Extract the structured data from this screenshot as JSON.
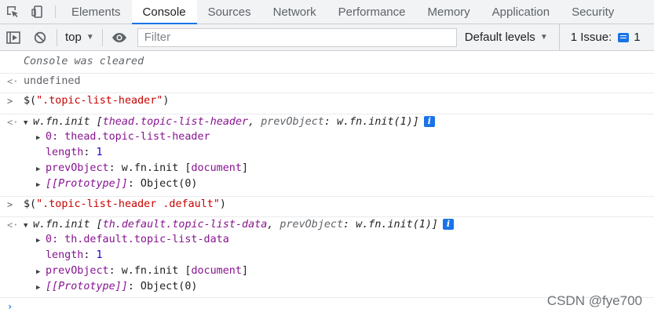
{
  "tabs": [
    "Elements",
    "Console",
    "Sources",
    "Network",
    "Performance",
    "Memory",
    "Application",
    "Security"
  ],
  "active_tab": "Console",
  "toolbar": {
    "context": "top",
    "filter_placeholder": "Filter",
    "levels": "Default levels",
    "issue_label": "1 Issue:",
    "issue_count": "1"
  },
  "console": {
    "cleared": "Console was cleared",
    "undefined": "undefined",
    "cmd1": {
      "prefix": "$(",
      "arg": "\".topic-list-header\"",
      "suffix": ")"
    },
    "result1": {
      "summary_head": "w.fn.init [",
      "summary_node": "thead.topic-list-header",
      "summary_sep": ", ",
      "summary_key": "prevObject",
      "summary_val": ": w.fn.init(1)]",
      "item0_key": "0",
      "item0_val": ": thead.topic-list-header",
      "length_key": "length",
      "length_val": "1",
      "prev_key": "prevObject",
      "prev_val": ": w.fn.init [",
      "prev_doc": "document",
      "prev_end": "]",
      "proto_key": "[[Prototype]]",
      "proto_val": ": Object(0)"
    },
    "cmd2": {
      "prefix": "$(",
      "arg": "\".topic-list-header .default\"",
      "suffix": ")"
    },
    "result2": {
      "summary_head": "w.fn.init [",
      "summary_node": "th.default.topic-list-data",
      "summary_sep": ", ",
      "summary_key": "prevObject",
      "summary_val": ": w.fn.init(1)]",
      "item0_key": "0",
      "item0_val": ": th.default.topic-list-data",
      "length_key": "length",
      "length_val": "1",
      "prev_key": "prevObject",
      "prev_val": ": w.fn.init [",
      "prev_doc": "document",
      "prev_end": "]",
      "proto_key": "[[Prototype]]",
      "proto_val": ": Object(0)"
    }
  },
  "watermark": "CSDN @fye700",
  "colors": {
    "accent": "#1a73e8",
    "key": "#881391",
    "string": "#c80000",
    "number": "#1c00cf"
  }
}
